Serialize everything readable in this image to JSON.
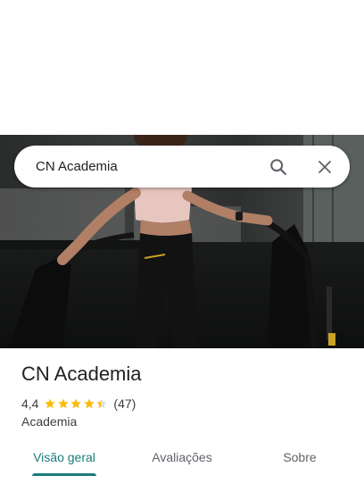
{
  "search": {
    "query": "CN Academia",
    "search_icon": "search-icon",
    "close_icon": "close-icon"
  },
  "hero": {
    "image": "photo of a woman on a treadmill in a gym"
  },
  "place": {
    "name": "CN Academia",
    "rating": "4,4",
    "stars_value": 4.4,
    "reviews_count": "(47)",
    "category": "Academia"
  },
  "tabs": [
    {
      "label": "Visão geral",
      "active": true
    },
    {
      "label": "Avaliações",
      "active": false
    },
    {
      "label": "Sobre",
      "active": false
    }
  ],
  "colors": {
    "accent": "#1a7c7a",
    "star": "#fbbc04",
    "star_empty": "#dadce0"
  }
}
